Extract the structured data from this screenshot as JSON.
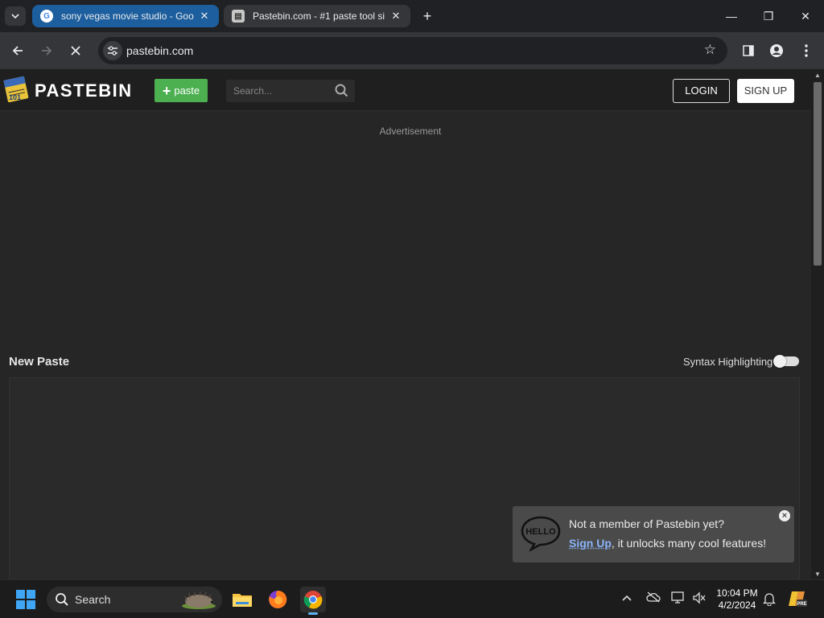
{
  "browser": {
    "tabs": [
      {
        "title": "sony vegas movie studio - Goo",
        "favicon": "google-icon",
        "active": false
      },
      {
        "title": "Pastebin.com - #1 paste tool si",
        "favicon": "pastebin-icon",
        "active": true
      }
    ],
    "url": "pastebin.com",
    "loading": true
  },
  "site": {
    "logo_text": "PASTEBIN",
    "logo_badge": "101",
    "paste_button": "paste",
    "search_placeholder": "Search...",
    "login": "LOGIN",
    "signup": "SIGN UP",
    "ad_label": "Advertisement",
    "new_paste_title": "New Paste",
    "syntax_label": "Syntax Highlighting",
    "syntax_enabled": false,
    "popup": {
      "bubble": "HELLO",
      "line1": "Not a member of Pastebin yet?",
      "link": "Sign Up",
      "line2_rest": ", it unlocks many cool features!"
    }
  },
  "taskbar": {
    "search_label": "Search",
    "time": "10:04 PM",
    "date": "4/2/2024",
    "colors": {
      "accent": "#3ea6f4"
    }
  },
  "colors": {
    "paste_green": "#4caf50",
    "page_bg": "#262626",
    "header_bg": "#1f1f1f",
    "active_tab": "#1d5f9e"
  }
}
